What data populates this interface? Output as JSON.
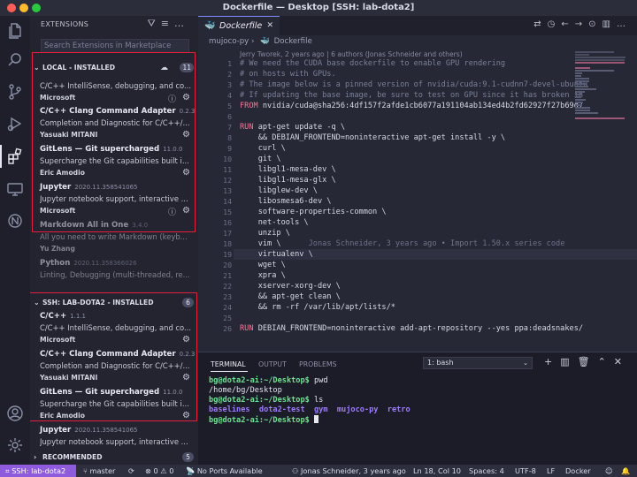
{
  "window": {
    "title": "Dockerfile — Desktop [SSH: lab-dota2]"
  },
  "colors": {
    "accent": "#8e5bdc",
    "highlight_box": "#e2203a",
    "prompt": "#6ee08e",
    "directory": "#9f7bff",
    "keyword": "#f27896"
  },
  "activity_bar": {
    "icons": [
      "files-icon",
      "search-icon",
      "source-control-icon",
      "run-debug-icon",
      "extensions-icon",
      "remote-explorer-icon",
      "docker-icon",
      "account-icon",
      "settings-gear-icon"
    ]
  },
  "sidebar": {
    "title": "EXTENSIONS",
    "search_placeholder": "Search Extensions in Marketplace",
    "local": {
      "header": "LOCAL - INSTALLED",
      "count": "11",
      "items": [
        {
          "name": "",
          "version": "",
          "desc": "C/C++ IntelliSense, debugging, and co...",
          "publisher": "Microsoft"
        },
        {
          "name": "C/C++ Clang Command Adapter",
          "version": "0.2.3",
          "desc": "Completion and Diagnostic for C/C++/...",
          "publisher": "Yasuaki MITANI"
        },
        {
          "name": "GitLens — Git supercharged",
          "version": "11.0.0",
          "desc": "Supercharge the Git capabilities built i...",
          "publisher": "Eric Amodio"
        },
        {
          "name": "Jupyter",
          "version": "2020.11.358541065",
          "desc": "Jupyter notebook support, interactive ...",
          "publisher": "Microsoft"
        },
        {
          "name": "Markdown All in One",
          "version": "3.4.0",
          "desc": "All you need to write Markdown (keyb...",
          "publisher": "Yu Zhang"
        },
        {
          "name": "Python",
          "version": "2020.11.358366026",
          "desc": "Linting, Debugging (multi-threaded, re...",
          "publisher": ""
        }
      ]
    },
    "ssh": {
      "header": "SSH: LAB-DOTA2 - INSTALLED",
      "count": "6",
      "items": [
        {
          "name": "C/C++",
          "version": "1.1.1",
          "desc": "C/C++ IntelliSense, debugging, and co...",
          "publisher": "Microsoft"
        },
        {
          "name": "C/C++ Clang Command Adapter",
          "version": "0.2.3",
          "desc": "Completion and Diagnostic for C/C++/...",
          "publisher": "Yasuaki MITANI"
        },
        {
          "name": "GitLens — Git supercharged",
          "version": "11.0.0",
          "desc": "Supercharge the Git capabilities built i...",
          "publisher": "Eric Amodio"
        },
        {
          "name": "Jupyter",
          "version": "2020.11.358541065",
          "desc": "Jupyter notebook support, interactive ...",
          "publisher": ""
        }
      ]
    },
    "recommended": {
      "header": "RECOMMENDED",
      "count": "5"
    }
  },
  "editor": {
    "tab_label": "Dockerfile",
    "breadcrumb": [
      "mujoco-py",
      "Dockerfile"
    ],
    "blame_header": "Jerry Tworek, 2 years ago | 6 authors (Jonas Schneider and others)",
    "inline_blame": "Jonas Schneider, 3 years ago • Import 1.50.x series code",
    "lines": [
      {
        "n": "1",
        "text": "# We need the CUDA base dockerfile to enable GPU rendering",
        "cls": "cmt"
      },
      {
        "n": "2",
        "text": "# on hosts with GPUs.",
        "cls": "cmt"
      },
      {
        "n": "3",
        "text": "# The image below is a pinned version of nvidia/cuda:9.1-cudnn7-devel-ubuntu",
        "cls": "cmt"
      },
      {
        "n": "4",
        "text": "# If updating the base image, be sure to test on GPU since it has broken in",
        "cls": "cmt"
      },
      {
        "n": "5",
        "kw": "FROM",
        "text": " nvidia/cuda@sha256:4df157f2afde1cb6077a191104ab134ed4b2fd62927f27b69d7",
        "cls": ""
      },
      {
        "n": "6",
        "text": "",
        "cls": ""
      },
      {
        "n": "7",
        "kw": "RUN",
        "text": " apt-get update -q \\",
        "cls": ""
      },
      {
        "n": "8",
        "text": "    && DEBIAN_FRONTEND=noninteractive apt-get install -y \\",
        "cls": ""
      },
      {
        "n": "9",
        "text": "    curl \\",
        "cls": ""
      },
      {
        "n": "10",
        "text": "    git \\",
        "cls": ""
      },
      {
        "n": "11",
        "text": "    libgl1-mesa-dev \\",
        "cls": ""
      },
      {
        "n": "12",
        "text": "    libgl1-mesa-glx \\",
        "cls": ""
      },
      {
        "n": "13",
        "text": "    libglew-dev \\",
        "cls": ""
      },
      {
        "n": "14",
        "text": "    libosmesa6-dev \\",
        "cls": ""
      },
      {
        "n": "15",
        "text": "    software-properties-common \\",
        "cls": ""
      },
      {
        "n": "16",
        "text": "    net-tools \\",
        "cls": ""
      },
      {
        "n": "17",
        "text": "    unzip \\",
        "cls": ""
      },
      {
        "n": "18",
        "text": "    vim \\",
        "cls": ""
      },
      {
        "n": "19",
        "text": "    virtualenv \\",
        "cls": ""
      },
      {
        "n": "20",
        "text": "    wget \\",
        "cls": ""
      },
      {
        "n": "21",
        "text": "    xpra \\",
        "cls": ""
      },
      {
        "n": "22",
        "text": "    xserver-xorg-dev \\",
        "cls": ""
      },
      {
        "n": "23",
        "text": "    && apt-get clean \\",
        "cls": ""
      },
      {
        "n": "24",
        "text": "    && rm -rf /var/lib/apt/lists/*",
        "cls": ""
      },
      {
        "n": "25",
        "text": "",
        "cls": ""
      },
      {
        "n": "26",
        "kw": "RUN",
        "text": " DEBIAN_FRONTEND=noninteractive add-apt-repository --yes ppa:deadsnakes/",
        "cls": ""
      }
    ]
  },
  "panel": {
    "tabs": [
      "TERMINAL",
      "OUTPUT",
      "PROBLEMS"
    ],
    "shell": "1: bash",
    "terminal": [
      {
        "prompt": "bg@dota2-ai:~/Desktop$",
        "cmd": " pwd"
      },
      {
        "out": "/home/bg/Desktop"
      },
      {
        "prompt": "bg@dota2-ai:~/Desktop$",
        "cmd": " ls"
      },
      {
        "dirs": "baselines  dota2-test  gym  mujoco-py  retro"
      },
      {
        "prompt": "bg@dota2-ai:~/Desktop$",
        "cmd": " "
      }
    ]
  },
  "status": {
    "remote": "SSH: lab-dota2",
    "branch": "master",
    "problems": "0",
    "warnings": "0",
    "ports": "No Ports Available",
    "blame": "Jonas Schneider, 3 years ago",
    "position": "Ln 18, Col 10",
    "spaces": "Spaces: 4",
    "encoding": "UTF-8",
    "eol": "LF",
    "language": "Docker"
  }
}
